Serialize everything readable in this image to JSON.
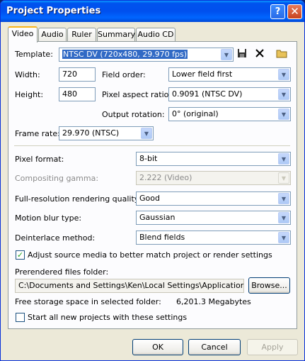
{
  "window": {
    "title": "Project Properties",
    "help_glyph": "?",
    "close_glyph": "✕"
  },
  "tabs": [
    "Video",
    "Audio",
    "Ruler",
    "Summary",
    "Audio CD"
  ],
  "template": {
    "label": "Template:",
    "value": "NTSC DV (720x480, 29.970 fps)"
  },
  "width": {
    "label": "Width:",
    "value": "720"
  },
  "height": {
    "label": "Height:",
    "value": "480"
  },
  "field_order": {
    "label": "Field order:",
    "value": "Lower field first"
  },
  "pixel_aspect": {
    "label": "Pixel aspect ratio:",
    "value": "0.9091 (NTSC DV)"
  },
  "output_rotation": {
    "label": "Output rotation:",
    "value": "0° (original)"
  },
  "frame_rate": {
    "label": "Frame rate:",
    "value": "29.970 (NTSC)"
  },
  "pixel_format": {
    "label": "Pixel format:",
    "value": "8-bit"
  },
  "compositing_gamma": {
    "label": "Compositing gamma:",
    "value": "2.222 (Video)"
  },
  "render_quality": {
    "label": "Full-resolution rendering quality:",
    "value": "Good"
  },
  "motion_blur": {
    "label": "Motion blur type:",
    "value": "Gaussian"
  },
  "deinterlace": {
    "label": "Deinterlace method:",
    "value": "Blend fields"
  },
  "adjust_media": {
    "label": "Adjust source media to better match project or render settings",
    "checked": true
  },
  "prerendered": {
    "label": "Prerendered files folder:",
    "path": "C:\\Documents and Settings\\Ken\\Local Settings\\Application Data\\Sony",
    "browse": "Browse..."
  },
  "free_space": {
    "label": "Free storage space in selected folder:",
    "value": "6,201.3 Megabytes"
  },
  "start_all": {
    "label": "Start all new projects with these settings",
    "checked": false
  },
  "buttons": {
    "ok": "OK",
    "cancel": "Cancel",
    "apply": "Apply"
  },
  "dropdown_arrow": "▼",
  "icons": [
    "save-icon",
    "delete-icon",
    "folder-icon"
  ]
}
